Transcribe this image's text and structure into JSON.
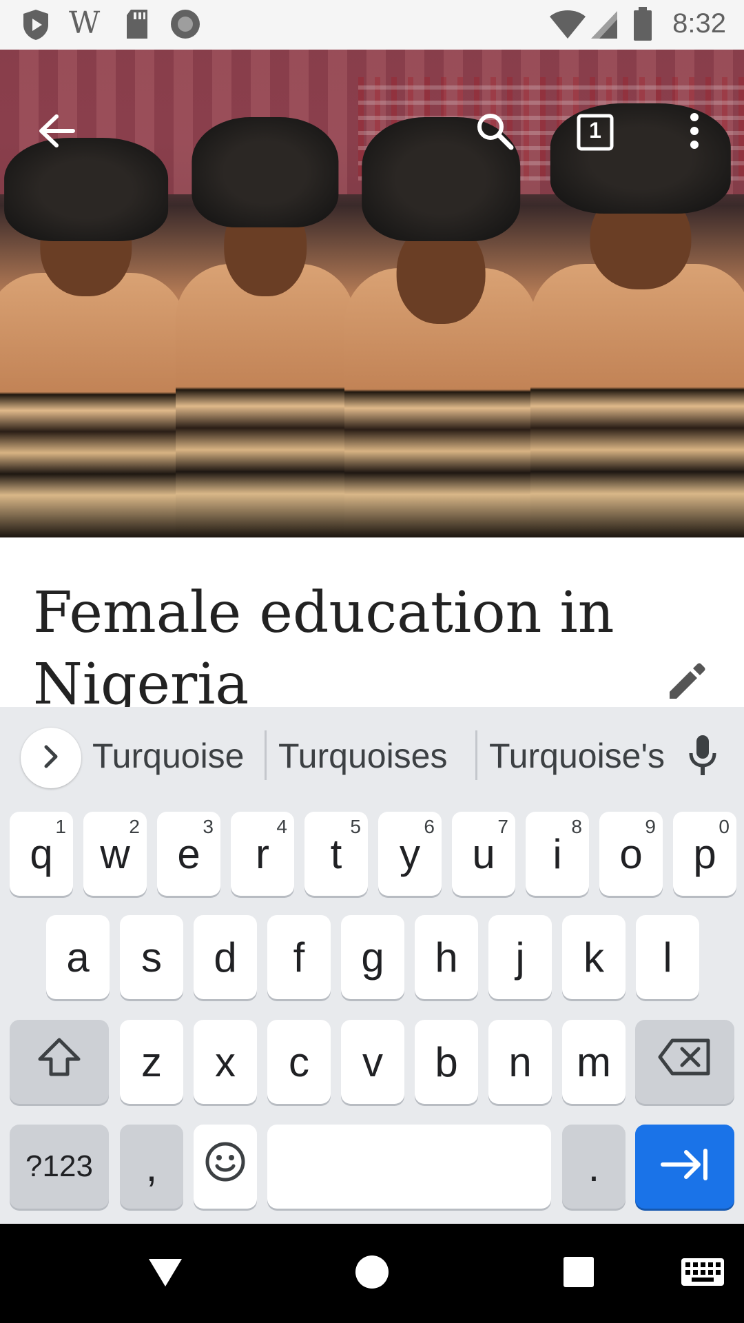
{
  "status_bar": {
    "time": "8:32",
    "left_icons": [
      "play-shield-icon",
      "wikipedia-w-icon",
      "sd-card-icon",
      "circle-record-icon"
    ],
    "right_icons": [
      "wifi-icon",
      "cell-signal-icon",
      "battery-icon"
    ],
    "wikipedia_glyph": "W"
  },
  "toolbar": {
    "tab_count": "1",
    "icons": [
      "back-arrow-icon",
      "search-icon",
      "tabs-icon",
      "more-vert-icon"
    ]
  },
  "article": {
    "title": "Female education in Nigeria"
  },
  "keyboard": {
    "suggestions": [
      "Turquoise",
      "Turquoises",
      "Turquoise's"
    ],
    "row1": [
      {
        "key": "q",
        "hint": "1"
      },
      {
        "key": "w",
        "hint": "2"
      },
      {
        "key": "e",
        "hint": "3"
      },
      {
        "key": "r",
        "hint": "4"
      },
      {
        "key": "t",
        "hint": "5"
      },
      {
        "key": "y",
        "hint": "6"
      },
      {
        "key": "u",
        "hint": "7"
      },
      {
        "key": "i",
        "hint": "8"
      },
      {
        "key": "o",
        "hint": "9"
      },
      {
        "key": "p",
        "hint": "0"
      }
    ],
    "row2": [
      "a",
      "s",
      "d",
      "f",
      "g",
      "h",
      "j",
      "k",
      "l"
    ],
    "row3": [
      "z",
      "x",
      "c",
      "v",
      "b",
      "n",
      "m"
    ],
    "symbols_label": "?123",
    "comma_label": ",",
    "period_label": ".",
    "colors": {
      "enter": "#1a73e8",
      "background": "#e8eaed"
    }
  },
  "nav_bar": {
    "icons": [
      "back-triangle-icon",
      "home-circle-icon",
      "recents-square-icon",
      "keyboard-switch-icon"
    ]
  }
}
